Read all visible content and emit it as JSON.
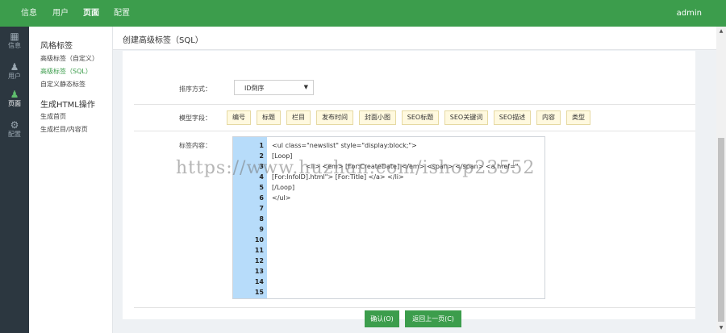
{
  "topbar": {
    "nav": [
      "信息",
      "用户",
      "页面",
      "配置"
    ],
    "active": "页面",
    "user": "admin"
  },
  "iconbar": {
    "items": [
      {
        "label": "信息",
        "icon": "info-icon"
      },
      {
        "label": "用户",
        "icon": "user-icon"
      },
      {
        "label": "页面",
        "icon": "page-icon"
      },
      {
        "label": "配置",
        "icon": "gear-icon"
      }
    ]
  },
  "sidebar": {
    "group1": "风格标签",
    "items1": [
      "高级标签（自定义）",
      "高级标签（SQL）",
      "自定义静态标签"
    ],
    "group2": "生成HTML操作",
    "items2": [
      "生成首页",
      "生成栏目/内容页"
    ]
  },
  "page": {
    "title": "创建高级标签（SQL）"
  },
  "form": {
    "sort_label": "排序方式：",
    "sort_value": "ID倒序",
    "fields_label": "模型字段：",
    "fields": [
      "编号",
      "标题",
      "栏目",
      "发布时间",
      "封面小图",
      "SEO标题",
      "SEO关键词",
      "SEO描述",
      "内容",
      "类型"
    ],
    "content_label": "标签内容："
  },
  "editor": {
    "line_numbers": [
      "1",
      "2",
      "3",
      "4",
      "5",
      "6",
      "7",
      "8",
      "9",
      "10",
      "11",
      "12",
      "13",
      "14",
      "15"
    ],
    "lines": [
      "<ul class=\"newslist\" style=\"display:block;\">",
      "[Loop]",
      "<li> <em> [For:CreateDate] </em> <span> </span> <a href=\"",
      "[For:InfoID].html\"> [For:Title] </a> </li>",
      "[/Loop]",
      "</ul>"
    ]
  },
  "footer": {
    "ok": "确认(O)",
    "back": "返回上一页(C)"
  },
  "watermark": "https://www.huzhan.com/ishop23552",
  "colors": {
    "brand": "#3c9d4c",
    "iconbar": "#2c3740",
    "gutter": "#b7dcfa",
    "field_button": "#fff9df"
  }
}
